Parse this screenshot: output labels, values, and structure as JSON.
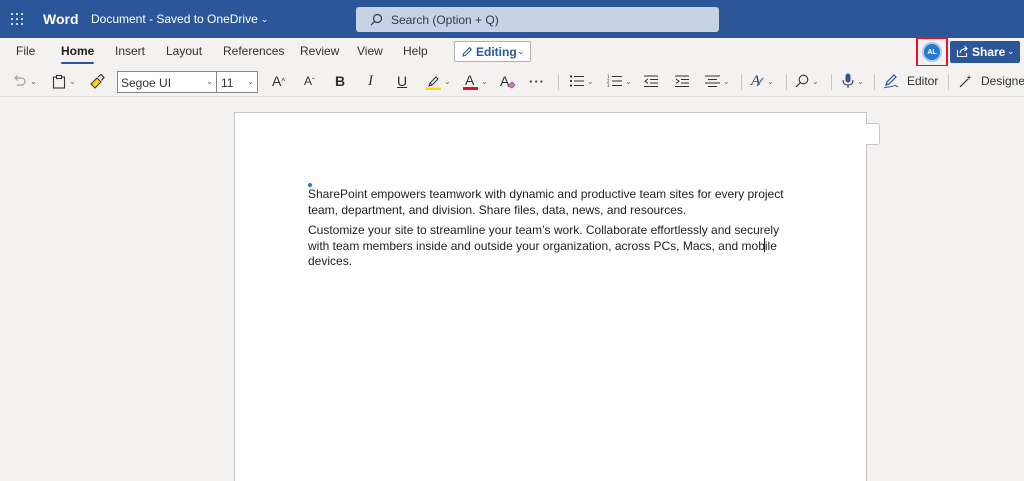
{
  "titlebar": {
    "app_name": "Word",
    "document_title": "Document - Saved to OneDrive",
    "search_placeholder": "Search (Option + Q)"
  },
  "tabs": [
    {
      "label": "File"
    },
    {
      "label": "Home",
      "active": true
    },
    {
      "label": "Insert"
    },
    {
      "label": "Layout"
    },
    {
      "label": "References"
    },
    {
      "label": "Review"
    },
    {
      "label": "View"
    },
    {
      "label": "Help"
    }
  ],
  "mode_button": {
    "label": "Editing"
  },
  "account": {
    "initials": "AL"
  },
  "share": {
    "label": "Share"
  },
  "toolbar": {
    "font_name": "Segoe UI",
    "font_size": "11",
    "grow_font": "A",
    "shrink_font": "A",
    "bold": "B",
    "italic": "I",
    "underline": "U",
    "font_color": "A",
    "text_effects": "A",
    "more": "···",
    "editor_label": "Editor",
    "designer_label": "Designer"
  },
  "document": {
    "paragraphs": [
      "SharePoint empowers teamwork with dynamic and productive team sites for every project team, department, and division. Share files, data, news, and resources.",
      "Customize your site to streamline your team’s work. Collaborate effortlessly and securely with team members inside and outside your organization, across PCs, Macs, and mobile devices."
    ]
  },
  "colors": {
    "brand": "#2b579a",
    "highlight": "#ffd800",
    "font_color": "#e81123",
    "focus_frame": "#e81123"
  }
}
